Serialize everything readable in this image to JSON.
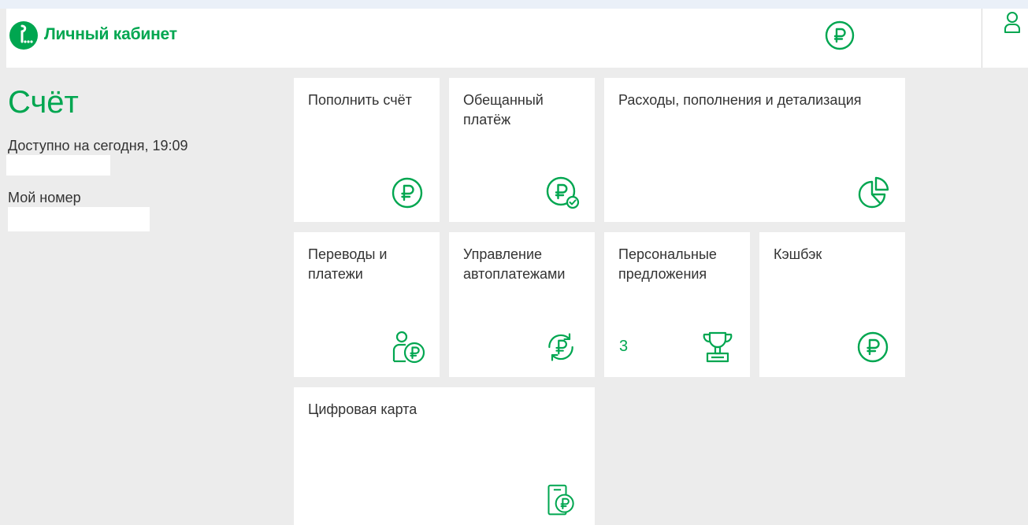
{
  "header": {
    "brand": "Личный кабинет",
    "balance_icon": "ruble-circle-icon",
    "profile_icon": "user-icon",
    "accent_color": "#00a650"
  },
  "account": {
    "title": "Счёт",
    "available_label": "Доступно на сегодня, 19:09",
    "my_number_label": "Мой номер"
  },
  "tiles": {
    "top_up": {
      "label": "Пополнить счёт",
      "icon": "ruble-circle-icon"
    },
    "promised_payment": {
      "label": "Обещанный\nплатёж",
      "icon": "ruble-check-icon"
    },
    "expenses": {
      "label": "Расходы, пополнения и детализация",
      "icon": "pie-chart-icon"
    },
    "transfers": {
      "label": "Переводы и\nплатежи",
      "icon": "person-ruble-icon"
    },
    "autopay": {
      "label": "Управление\nавтоплатежами",
      "icon": "ruble-cycle-icon"
    },
    "offers": {
      "label": "Персональные\nпредложения",
      "count": "3",
      "icon": "trophy-icon"
    },
    "cashback": {
      "label": "Кэшбэк",
      "icon": "ruble-circle-icon"
    },
    "digital_card": {
      "label": "Цифровая карта",
      "icon": "card-ruble-icon"
    }
  }
}
